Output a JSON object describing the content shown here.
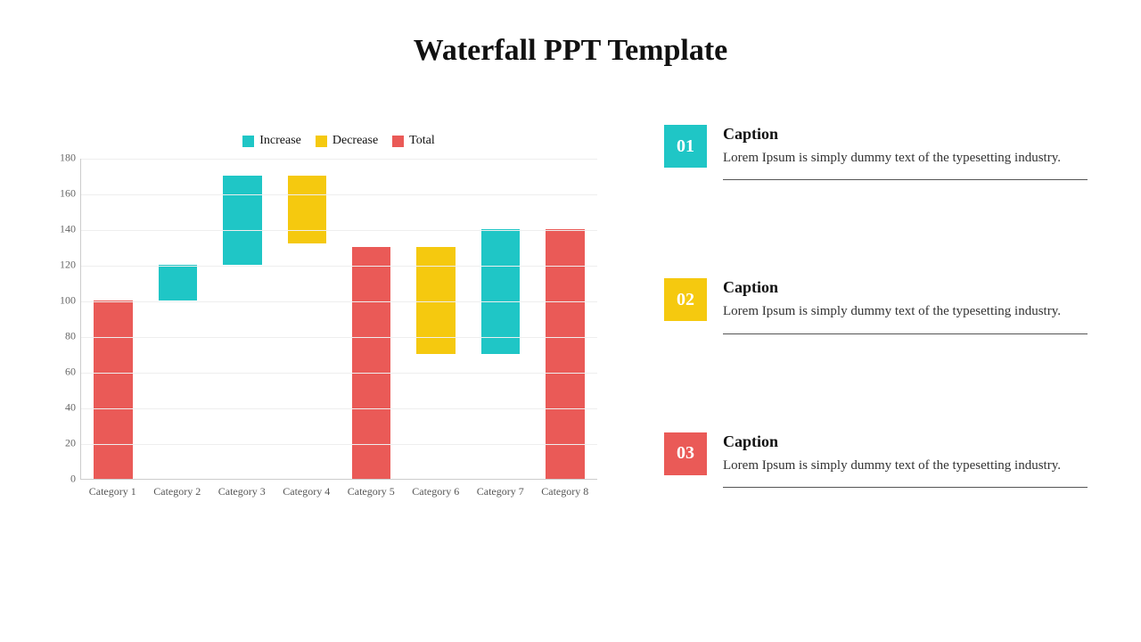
{
  "title": "Waterfall PPT Template",
  "colors": {
    "increase": "#1fc6c6",
    "decrease": "#f5c90f",
    "total": "#ea5a57"
  },
  "legend": [
    {
      "key": "increase",
      "label": "Increase"
    },
    {
      "key": "decrease",
      "label": "Decrease"
    },
    {
      "key": "total",
      "label": "Total"
    }
  ],
  "chart_data": {
    "type": "bar",
    "title": "",
    "xlabel": "",
    "ylabel": "",
    "ylim": [
      0,
      180
    ],
    "yticks": [
      0,
      20,
      40,
      60,
      80,
      100,
      120,
      140,
      160,
      180
    ],
    "categories": [
      "Category 1",
      "Category 2",
      "Category 3",
      "Category 4",
      "Category 5",
      "Category 6",
      "Category 7",
      "Category 8"
    ],
    "bars": [
      {
        "category": "Category 1",
        "series": "total",
        "start": 0,
        "end": 100
      },
      {
        "category": "Category 2",
        "series": "increase",
        "start": 100,
        "end": 120
      },
      {
        "category": "Category 3",
        "series": "increase",
        "start": 120,
        "end": 170
      },
      {
        "category": "Category 4",
        "series": "decrease",
        "start": 170,
        "end": 132
      },
      {
        "category": "Category 5",
        "series": "total",
        "start": 0,
        "end": 130
      },
      {
        "category": "Category 6",
        "series": "decrease",
        "start": 130,
        "end": 70
      },
      {
        "category": "Category 7",
        "series": "increase",
        "start": 70,
        "end": 140
      },
      {
        "category": "Category 8",
        "series": "total",
        "start": 0,
        "end": 140
      }
    ]
  },
  "captions": [
    {
      "num": "01",
      "colorKey": "increase",
      "title": "Caption",
      "text": "Lorem Ipsum is simply dummy text of the typesetting industry."
    },
    {
      "num": "02",
      "colorKey": "decrease",
      "title": "Caption",
      "text": "Lorem Ipsum is simply dummy text of the typesetting industry."
    },
    {
      "num": "03",
      "colorKey": "total",
      "title": "Caption",
      "text": "Lorem Ipsum is simply dummy text of the typesetting industry."
    }
  ]
}
